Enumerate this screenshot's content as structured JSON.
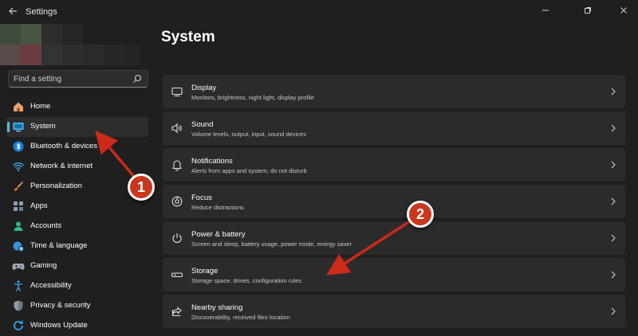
{
  "window": {
    "title": "Settings",
    "back_icon": "arrow-left-icon",
    "controls": [
      "minimize-icon",
      "maximize-icon",
      "close-icon"
    ]
  },
  "search": {
    "placeholder": "Find a setting",
    "icon": "search-icon"
  },
  "sidebar": {
    "items": [
      {
        "label": "Home",
        "icon": "home-icon",
        "active": false
      },
      {
        "label": "System",
        "icon": "monitor-icon",
        "active": true
      },
      {
        "label": "Bluetooth & devices",
        "icon": "bluetooth-icon",
        "active": false
      },
      {
        "label": "Network & internet",
        "icon": "wifi-icon",
        "active": false
      },
      {
        "label": "Personalization",
        "icon": "brush-icon",
        "active": false
      },
      {
        "label": "Apps",
        "icon": "apps-icon",
        "active": false
      },
      {
        "label": "Accounts",
        "icon": "person-icon",
        "active": false
      },
      {
        "label": "Time & language",
        "icon": "globe-clock-icon",
        "active": false
      },
      {
        "label": "Gaming",
        "icon": "gamepad-icon",
        "active": false
      },
      {
        "label": "Accessibility",
        "icon": "accessibility-icon",
        "active": false
      },
      {
        "label": "Privacy & security",
        "icon": "shield-icon",
        "active": false
      },
      {
        "label": "Windows Update",
        "icon": "update-icon",
        "active": false
      }
    ]
  },
  "main": {
    "title": "System",
    "cards": [
      {
        "title": "Display",
        "subtitle": "Monitors, brightness, night light, display profile",
        "icon": "display-icon"
      },
      {
        "title": "Sound",
        "subtitle": "Volume levels, output, input, sound devices",
        "icon": "speaker-icon"
      },
      {
        "title": "Notifications",
        "subtitle": "Alerts from apps and system, do not disturb",
        "icon": "bell-icon"
      },
      {
        "title": "Focus",
        "subtitle": "Reduce distractions",
        "icon": "focus-icon"
      },
      {
        "title": "Power & battery",
        "subtitle": "Screen and sleep, battery usage, power mode, energy saver",
        "icon": "power-icon"
      },
      {
        "title": "Storage",
        "subtitle": "Storage space, drives, configuration rules",
        "icon": "storage-icon"
      },
      {
        "title": "Nearby sharing",
        "subtitle": "Discoverability, received files location",
        "icon": "share-icon"
      }
    ]
  },
  "annotations": {
    "badge1": "1",
    "badge2": "2",
    "arrow_color": "#cc2a1a"
  },
  "colors": {
    "accent": "#4cc2ff",
    "background": "#1f1f1f",
    "card": "#2b2b2b",
    "badge": "#c9371d"
  }
}
